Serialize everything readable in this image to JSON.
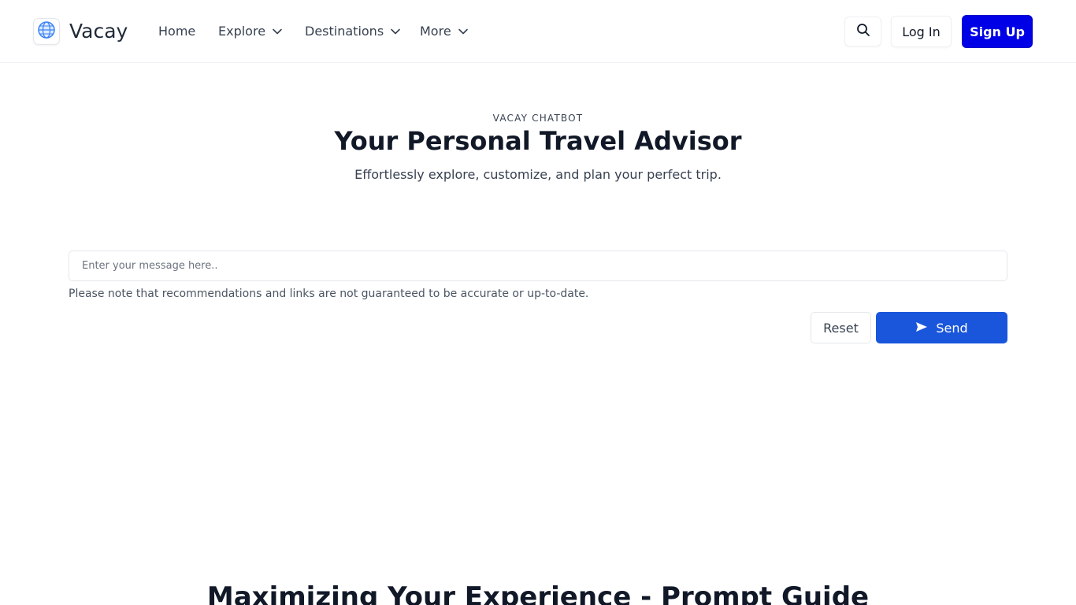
{
  "header": {
    "brand": "Vacay",
    "nav": [
      {
        "label": "Home"
      },
      {
        "label": "Explore"
      },
      {
        "label": "Destinations"
      },
      {
        "label": "More"
      }
    ],
    "login_label": "Log In",
    "signup_label": "Sign Up"
  },
  "hero": {
    "eyebrow": "VACAY CHATBOT",
    "title": "Your Personal Travel Advisor",
    "subtitle": "Effortlessly explore, customize, and plan your perfect trip."
  },
  "chat": {
    "placeholder": "Enter your message here..",
    "value": "",
    "disclaimer": "Please note that recommendations and links are not guaranteed to be accurate or up-to-date.",
    "reset_label": "Reset",
    "send_label": "Send"
  },
  "guide": {
    "title": "Maximizing Your Experience - Prompt Guide"
  },
  "colors": {
    "signup_bg": "#0000e6",
    "send_bg": "#1a56db"
  },
  "icons": [
    "globe-logo-icon",
    "chevron-down-icon",
    "search-icon",
    "send-icon"
  ]
}
